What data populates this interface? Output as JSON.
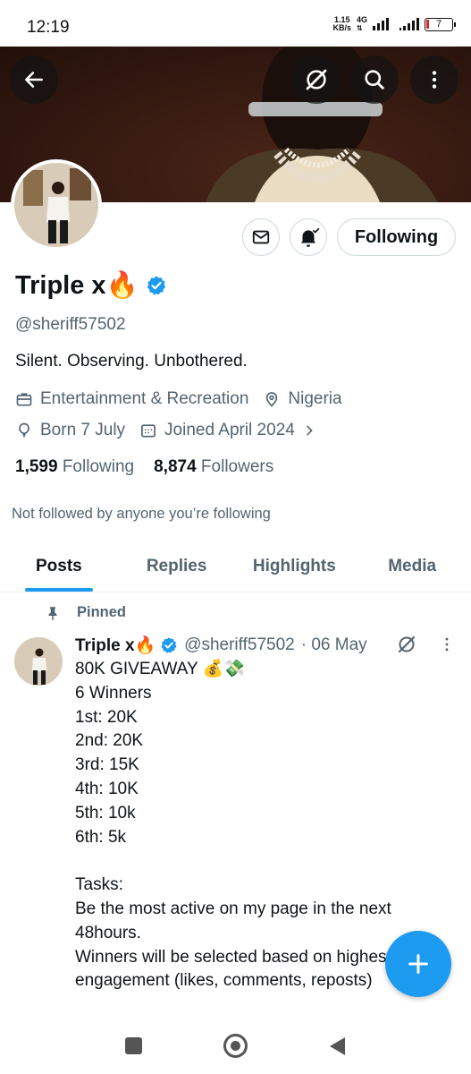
{
  "status_bar": {
    "time": "12:19",
    "net_speed_value": "1.15",
    "net_speed_unit": "KB/s",
    "net_type": "4G",
    "battery_level": "7"
  },
  "profile": {
    "display_name": "Triple x🔥",
    "handle": "@sheriff57502",
    "bio": "Silent. Observing. Unbothered.",
    "category": "Entertainment & Recreation",
    "location": "Nigeria",
    "birthday": "Born 7 July",
    "joined": "Joined April 2024",
    "following_count": "1,599",
    "following_label": "Following",
    "followers_count": "8,874",
    "followers_label": "Followers",
    "not_followed_text": "Not followed by anyone you’re following",
    "follow_button_label": "Following",
    "verified_color": "#1d9bf0"
  },
  "tabs": [
    {
      "label": "Posts",
      "active": true
    },
    {
      "label": "Replies",
      "active": false
    },
    {
      "label": "Highlights",
      "active": false
    },
    {
      "label": "Media",
      "active": false
    }
  ],
  "pinned_post": {
    "pinned_label": "Pinned",
    "author_name": "Triple x🔥",
    "author_handle": "@sheriff57502",
    "date": "· 06 May",
    "text": "80K GIVEAWAY 💰💸\n6 Winners\n1st:  20K\n2nd: 20K\n3rd: 15K\n4th: 10K\n5th: 10k\n6th: 5k\n\nTasks:\nBe the most active on my page in the next 48hours.\nWinners will be selected based on highest engagement (likes, comments, reposts)"
  },
  "icons": {
    "back": "arrow-left-icon",
    "grok": "grok-icon",
    "search": "search-icon",
    "more": "more-vertical-icon",
    "message": "mail-icon",
    "notify": "bell-check-icon",
    "compose": "plus-icon"
  },
  "accent_color": "#1d9bf0"
}
